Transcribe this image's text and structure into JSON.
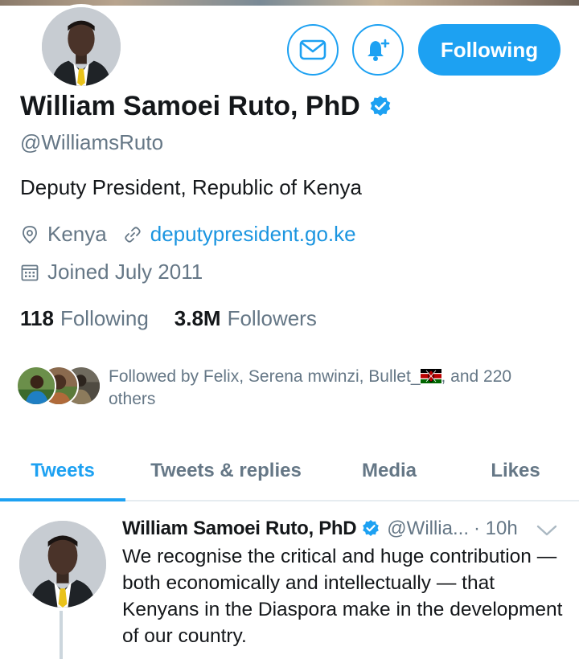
{
  "actions": {
    "message_icon": "envelope-icon",
    "notify_icon": "bell-plus-icon",
    "follow_label": "Following"
  },
  "profile": {
    "name": "William Samoei Ruto, PhD",
    "handle": "@WilliamsRuto",
    "bio": "Deputy President, Republic of Kenya",
    "location": "Kenya",
    "website": "deputypresident.go.ke",
    "joined": "Joined July 2011",
    "following_count": "118",
    "following_label": "Following",
    "followers_count": "3.8M",
    "followers_label": "Followers",
    "followed_by_prefix": "Followed by Felix, Serena mwinzi, Bullet_",
    "followed_by_flag": "kenya-flag-emoji",
    "followed_by_suffix": ", and 220 others"
  },
  "tabs": [
    {
      "label": "Tweets",
      "active": true
    },
    {
      "label": "Tweets & replies",
      "active": false
    },
    {
      "label": "Media",
      "active": false
    },
    {
      "label": "Likes",
      "active": false
    }
  ],
  "tweet": {
    "name": "William Samoei Ruto, PhD",
    "handle": "@Willia...",
    "time": "· 10h",
    "text": "We recognise the critical and huge contribution — both economically and intellectually — that Kenyans in the Diaspora make in the development of our country."
  },
  "colors": {
    "accent": "#1da1f2",
    "link": "#1b95e0",
    "secondary_text": "#657786",
    "primary_text": "#14171a",
    "border": "#e6ecf0"
  }
}
